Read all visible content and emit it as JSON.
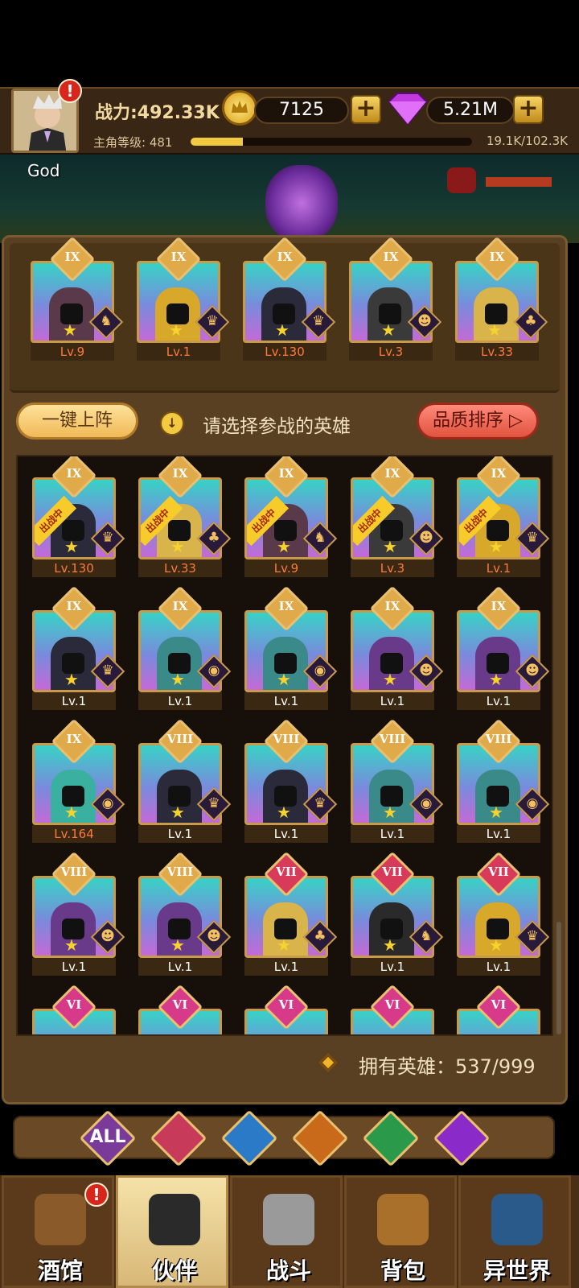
{
  "header": {
    "power": "战力:492.33K",
    "gold": "7125",
    "gems": "5.21M",
    "level_label": "主角等级: 481",
    "xp_text": "19.1K/102.3K",
    "xp_fraction": 0.187,
    "player_name": "God",
    "plus": "+",
    "alert": "!"
  },
  "team": [
    {
      "rank": "IX",
      "level": "Lv.9",
      "faction": "beast",
      "color": "#5a3a4a"
    },
    {
      "rank": "IX",
      "level": "Lv.1",
      "faction": "human",
      "color": "#d8a82a"
    },
    {
      "rank": "IX",
      "level": "Lv.130",
      "faction": "human",
      "color": "#2a2a3a"
    },
    {
      "rank": "IX",
      "level": "Lv.3",
      "faction": "demon",
      "color": "#3a3a3a"
    },
    {
      "rank": "IX",
      "level": "Lv.33",
      "faction": "elf",
      "color": "#d8b44a"
    }
  ],
  "toolbar": {
    "auto_deploy": "一键上阵",
    "hint": "请选择参战的英雄",
    "sort": "品质排序 ▷",
    "hint_icon": "↓"
  },
  "deployed_label": "出战中",
  "heroes": [
    {
      "rank": "IX",
      "level": "Lv.130",
      "faction": "human",
      "color": "#2a2a3a",
      "deployed": true,
      "top": true
    },
    {
      "rank": "IX",
      "level": "Lv.33",
      "faction": "elf",
      "color": "#d8b44a",
      "deployed": true,
      "top": true
    },
    {
      "rank": "IX",
      "level": "Lv.9",
      "faction": "beast",
      "color": "#5a3a4a",
      "deployed": true,
      "top": true
    },
    {
      "rank": "IX",
      "level": "Lv.3",
      "faction": "demon",
      "color": "#3a3a3a",
      "deployed": true,
      "top": true
    },
    {
      "rank": "IX",
      "level": "Lv.1",
      "faction": "human",
      "color": "#d8a82a",
      "deployed": true,
      "top": true
    },
    {
      "rank": "IX",
      "level": "Lv.1",
      "faction": "human",
      "color": "#2a2a3a"
    },
    {
      "rank": "IX",
      "level": "Lv.1",
      "faction": "sea",
      "color": "#3a8a8a"
    },
    {
      "rank": "IX",
      "level": "Lv.1",
      "faction": "sea",
      "color": "#3a8a8a"
    },
    {
      "rank": "IX",
      "level": "Lv.1",
      "faction": "demon",
      "color": "#6a3a8a"
    },
    {
      "rank": "IX",
      "level": "Lv.1",
      "faction": "demon",
      "color": "#6a3a8a"
    },
    {
      "rank": "IX",
      "level": "Lv.164",
      "faction": "sea",
      "color": "#3ab0a0",
      "top": true
    },
    {
      "rank": "VIII",
      "level": "Lv.1",
      "faction": "human",
      "color": "#2a2a3a"
    },
    {
      "rank": "VIII",
      "level": "Lv.1",
      "faction": "human",
      "color": "#2a2a3a"
    },
    {
      "rank": "VIII",
      "level": "Lv.1",
      "faction": "sea",
      "color": "#3a8a8a"
    },
    {
      "rank": "VIII",
      "level": "Lv.1",
      "faction": "sea",
      "color": "#3a8a8a"
    },
    {
      "rank": "VIII",
      "level": "Lv.1",
      "faction": "demon",
      "color": "#6a3a8a"
    },
    {
      "rank": "VIII",
      "level": "Lv.1",
      "faction": "demon",
      "color": "#6a3a8a"
    },
    {
      "rank": "VII",
      "level": "Lv.1",
      "faction": "elf",
      "color": "#d8b44a"
    },
    {
      "rank": "VII",
      "level": "Lv.1",
      "faction": "beast",
      "color": "#2a2a2a"
    },
    {
      "rank": "VII",
      "level": "Lv.1",
      "faction": "human",
      "color": "#d8a82a"
    },
    {
      "rank": "VI",
      "level": "",
      "faction": "",
      "color": "#3a8a8a"
    },
    {
      "rank": "VI",
      "level": "",
      "faction": "",
      "color": "#3a8a8a"
    },
    {
      "rank": "VI",
      "level": "",
      "faction": "",
      "color": "#3a8a8a"
    },
    {
      "rank": "VI",
      "level": "",
      "faction": "",
      "color": "#3a8a8a"
    },
    {
      "rank": "VI",
      "level": "",
      "faction": "",
      "color": "#3a8a8a"
    }
  ],
  "owned": "拥有英雄：537/999",
  "filters": [
    {
      "label": "ALL",
      "icon": "all-icon",
      "color": "#7a3a9a"
    },
    {
      "label": "",
      "icon": "human-crown-icon",
      "color": "#c83a5a"
    },
    {
      "label": "",
      "icon": "sea-creature-icon",
      "color": "#2a7ac8"
    },
    {
      "label": "",
      "icon": "lion-icon",
      "color": "#c86a1a"
    },
    {
      "label": "",
      "icon": "elf-icon",
      "color": "#2a9a4a"
    },
    {
      "label": "",
      "icon": "demon-icon",
      "color": "#8a2ac8"
    }
  ],
  "nav": [
    {
      "label": "酒馆",
      "icon": "beer-mug-icon",
      "alert": true
    },
    {
      "label": "伙伴",
      "icon": "companion-icon",
      "active": true
    },
    {
      "label": "战斗",
      "icon": "crossed-swords-icon"
    },
    {
      "label": "背包",
      "icon": "backpack-icon"
    },
    {
      "label": "异世界",
      "icon": "portal-icon"
    }
  ],
  "colors": {
    "rank_IX": "#e0a94a",
    "rank_VIII": "#e0a94a",
    "rank_VII": "#d83a5a",
    "rank_VI": "#d83a8a"
  }
}
